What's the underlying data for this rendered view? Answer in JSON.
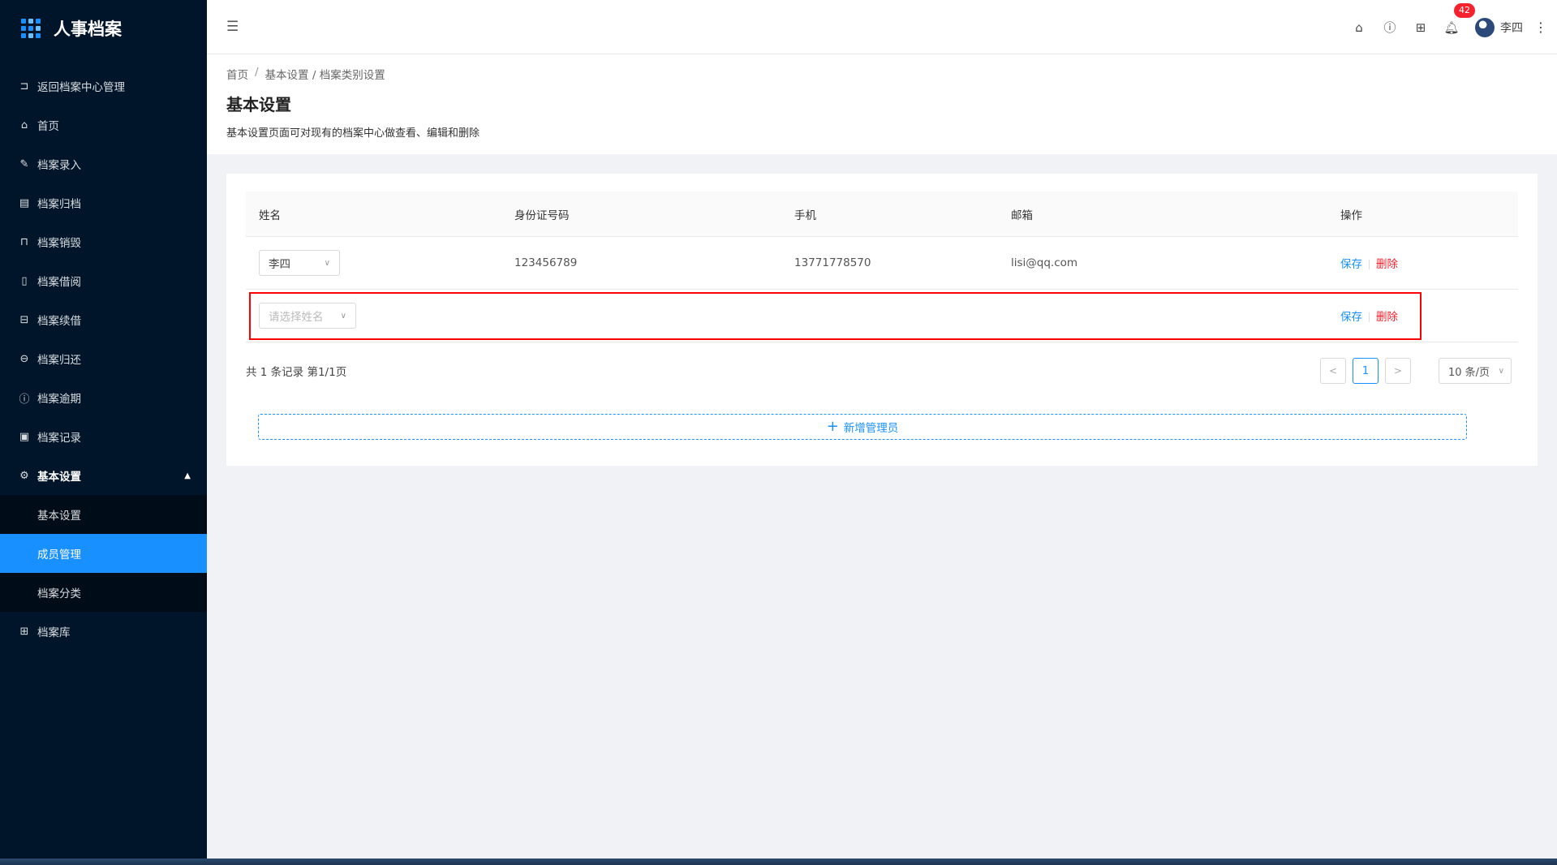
{
  "app": {
    "title": "人事档案"
  },
  "sidebar": {
    "items": [
      {
        "label": "返回档案中心管理",
        "icon": "return-icon",
        "glyph": "⊐"
      },
      {
        "label": "首页",
        "icon": "home-icon",
        "glyph": "⌂"
      },
      {
        "label": "档案录入",
        "icon": "edit-icon",
        "glyph": "✎"
      },
      {
        "label": "档案归档",
        "icon": "archive-icon",
        "glyph": "▤"
      },
      {
        "label": "档案销毁",
        "icon": "trash-icon",
        "glyph": "⊓"
      },
      {
        "label": "档案借阅",
        "icon": "book-icon",
        "glyph": "▯"
      },
      {
        "label": "档案续借",
        "icon": "renew-icon",
        "glyph": "⊟"
      },
      {
        "label": "档案归还",
        "icon": "return-box-icon",
        "glyph": "⊖"
      },
      {
        "label": "档案逾期",
        "icon": "alert-icon",
        "glyph": "ⓘ"
      },
      {
        "label": "档案记录",
        "icon": "record-icon",
        "glyph": "▣"
      }
    ],
    "settings": {
      "label": "基本设置",
      "icon": "gear-icon",
      "children": [
        "基本设置",
        "成员管理",
        "档案分类"
      ],
      "active": "成员管理"
    },
    "library": {
      "label": "档案库",
      "icon": "grid-icon",
      "glyph": "⊞"
    }
  },
  "header": {
    "notifications": "42",
    "user": "李四"
  },
  "page": {
    "breadcrumb": [
      "首页",
      "基本设置 / 档案类别设置"
    ],
    "breadcrumb_sep": "/",
    "title": "基本设置",
    "description": "基本设置页面可对现有的档案中心做查看、编辑和删除"
  },
  "table": {
    "columns": [
      "姓名",
      "身份证号码",
      "手机",
      "邮箱",
      "操作"
    ],
    "rows": [
      {
        "name": "李四",
        "id_number": "123456789",
        "phone": "13771778570",
        "email": "lisi@qq.com"
      }
    ],
    "new_row_placeholder": "请选择姓名",
    "save_label": "保存",
    "delete_label": "删除"
  },
  "pagination": {
    "summary": "共 1 条记录 第1/1页",
    "current_page": "1",
    "page_size": "10 条/页"
  },
  "add_button": {
    "label": "新增管理员"
  },
  "colors": {
    "primary": "#1890ff",
    "danger": "#f5222d",
    "sidebar_bg": "#001529",
    "highlight": "#ff0000"
  }
}
